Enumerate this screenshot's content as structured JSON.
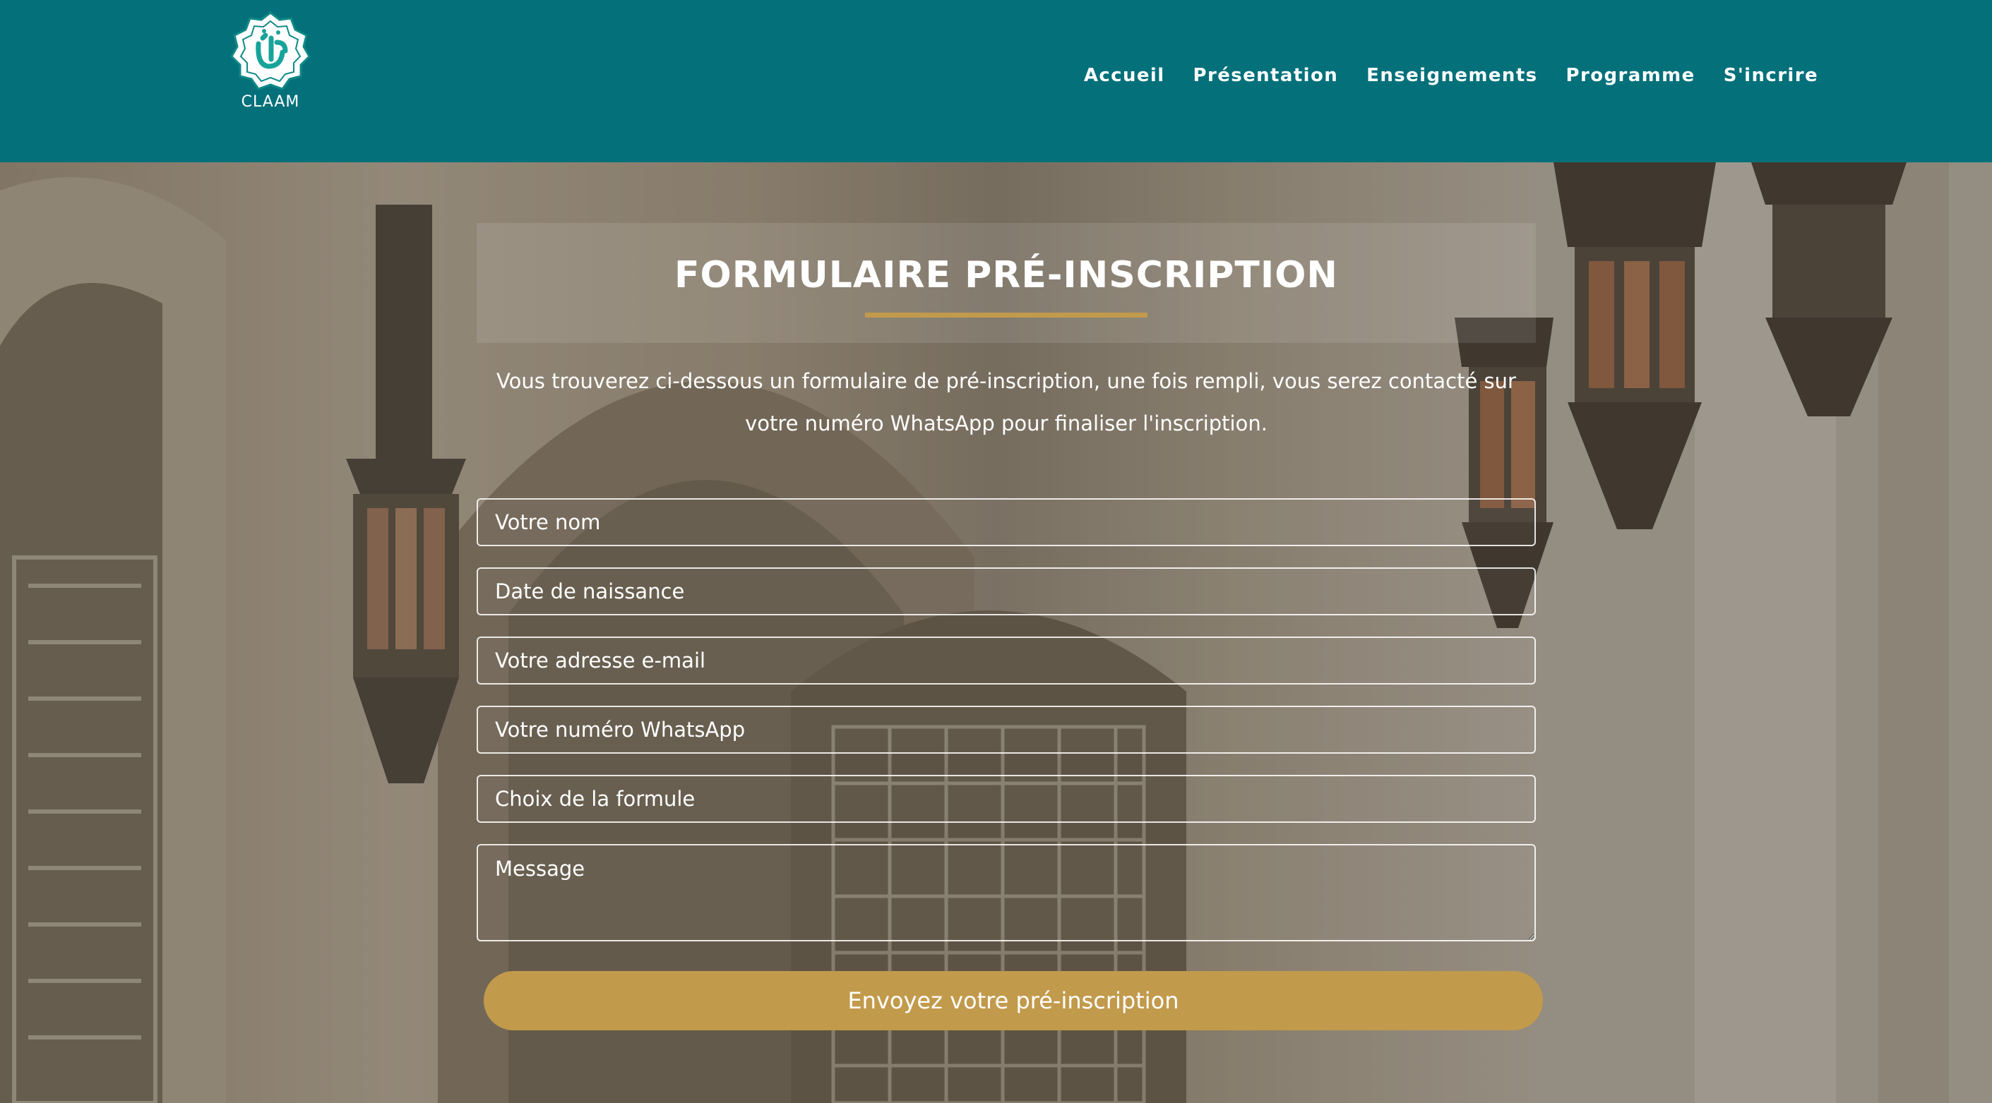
{
  "header": {
    "logo_text": "CLAAM",
    "nav": [
      {
        "label": "Accueil"
      },
      {
        "label": "Présentation"
      },
      {
        "label": "Enseignements"
      },
      {
        "label": "Programme"
      },
      {
        "label": "S'incrire"
      }
    ]
  },
  "form": {
    "title": "FORMULAIRE PRÉ-INSCRIPTION",
    "intro": "Vous trouverez ci-dessous un formulaire de pré-inscription, une fois rempli, vous serez contacté sur votre numéro WhatsApp pour finaliser l'inscription.",
    "fields": {
      "name": {
        "placeholder": "Votre nom",
        "value": ""
      },
      "birthdate": {
        "placeholder": "Date de naissance",
        "value": ""
      },
      "email": {
        "placeholder": "Votre adresse e-mail",
        "value": ""
      },
      "whatsapp": {
        "placeholder": "Votre numéro WhatsApp",
        "value": ""
      },
      "formula": {
        "placeholder": "Choix de la formule",
        "value": ""
      },
      "message": {
        "placeholder": "Message",
        "value": ""
      }
    },
    "submit_label": "Envoyez votre pré-inscription"
  },
  "colors": {
    "header_bg": "#03707a",
    "accent": "#c29a4c",
    "text": "#ffffff"
  },
  "icons": {
    "logo": "claam-calligraphy-logo"
  }
}
